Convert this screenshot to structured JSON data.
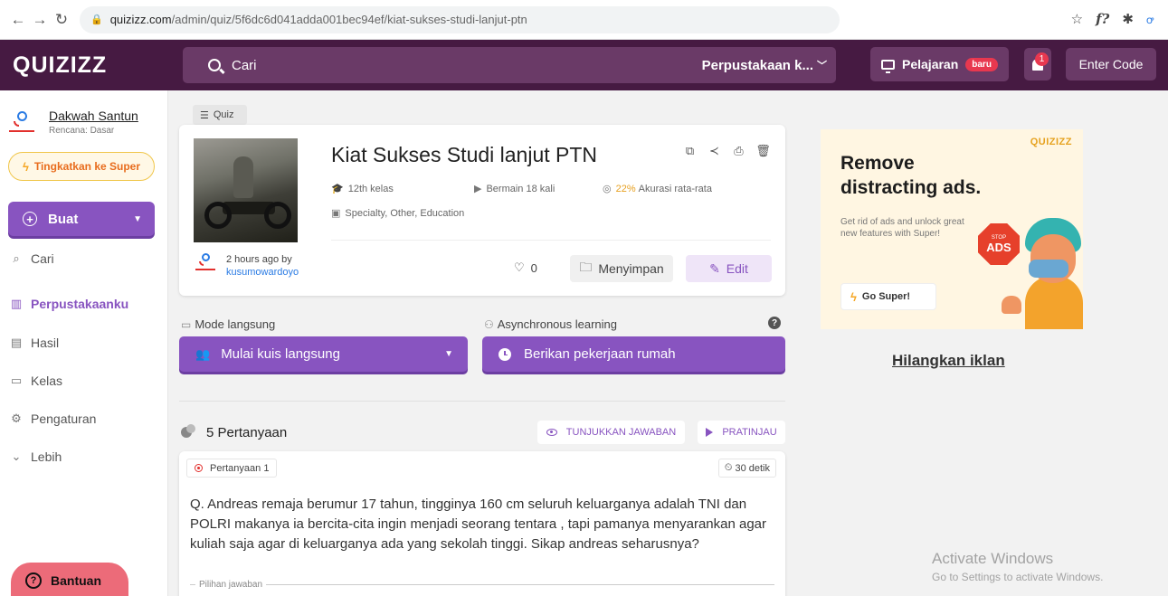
{
  "browser": {
    "url_host": "quizizz.com",
    "url_path": "/admin/quiz/5f6dc6d041adda001bec94ef/kiat-sukses-studi-lanjut-ptn"
  },
  "header": {
    "logo": "QUIZIZZ",
    "search_placeholder": "Cari",
    "library_label": "Perpustakaan k...",
    "lesson_label": "Pelajaran",
    "new_badge": "baru",
    "notification_count": "1",
    "enter_code_label": "Enter Code",
    "brand_color": "#461a42",
    "accent_color": "#8854c0"
  },
  "sidebar": {
    "user_name": "Dakwah Santun",
    "user_plan": "Rencana: Dasar",
    "upgrade_label": "Tingkatkan ke Super",
    "create_label": "Buat",
    "items": [
      {
        "label": "Cari",
        "icon": "search-icon"
      },
      {
        "label": "Perpustakaanku",
        "icon": "library-icon"
      },
      {
        "label": "Hasil",
        "icon": "chart-icon"
      },
      {
        "label": "Kelas",
        "icon": "class-icon"
      },
      {
        "label": "Pengaturan",
        "icon": "gear-icon"
      },
      {
        "label": "Lebih",
        "icon": "chevron-down-icon"
      }
    ],
    "help_label": "Bantuan"
  },
  "quiz": {
    "type_tag": "Quiz",
    "title": "Kiat Sukses Studi lanjut PTN",
    "grade": "12th kelas",
    "plays": "Bermain 18 kali",
    "accuracy_value": "22%",
    "accuracy_label": "Akurasi rata-rata",
    "subjects": "Specialty, Other, Education",
    "created_time": "2 hours ago by",
    "author": "kusumowardoyo",
    "likes": "0",
    "save_label": "Menyimpan",
    "edit_label": "Edit"
  },
  "modes": {
    "live_label": "Mode langsung",
    "async_label": "Asynchronous learning",
    "live_button": "Mulai kuis langsung",
    "homework_button": "Berikan pekerjaan rumah"
  },
  "questions": {
    "count_label": "5 Pertanyaan",
    "show_answers_label": "TUNJUKKAN JAWABAN",
    "preview_label": "PRATINJAU",
    "items": [
      {
        "number_label": "Pertanyaan 1",
        "time_label": "30 detik",
        "text": "Q. Andreas remaja berumur 17 tahun, tingginya 160 cm seluruh keluarganya adalah TNI dan POLRI makanya ia bercita-cita ingin menjadi seorang tentara , tapi pamanya menyarankan agar kuliah saja agar di keluarganya ada yang sekolah tinggi. Sikap andreas seharusnya?",
        "options_label": "Pilihan jawaban"
      }
    ]
  },
  "ad": {
    "logo": "QUIZIZZ",
    "title_line1": "Remove",
    "title_line2": "distracting ads.",
    "text": "Get rid of ads and unlock great new features with Super!",
    "stop_top": "STOP",
    "stop_main": "ADS",
    "button_label": "Go Super!",
    "remove_link": "Hilangkan iklan"
  },
  "watermark": {
    "line1": "Activate Windows",
    "line2": "Go to Settings to activate Windows."
  }
}
